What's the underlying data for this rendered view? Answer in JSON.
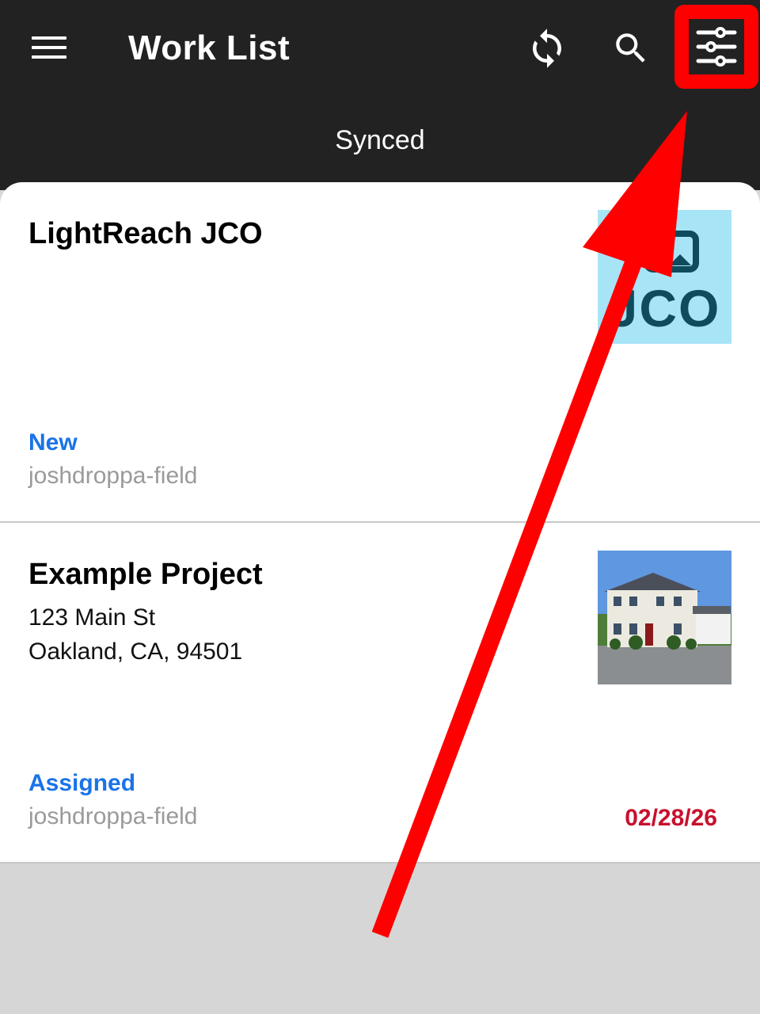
{
  "header": {
    "title": "Work List",
    "sync_status": "Synced",
    "icons": [
      "menu-icon",
      "sync-icon",
      "search-icon",
      "filter-icon"
    ],
    "background": "#222222"
  },
  "work_items": [
    {
      "name": "LightReach JCO",
      "status": "New",
      "assignee": "joshdroppa-field",
      "thumbnail_text": "JCO"
    },
    {
      "name": "Example Project",
      "address_line1": "123 Main St",
      "address_line2": "Oakland, CA, 94501",
      "status": "Assigned",
      "assignee": "joshdroppa-field",
      "due_date": "02/28/26"
    }
  ],
  "colors": {
    "status_blue": "#1a73e8",
    "date_red": "#c8102e",
    "annotation_red": "#ff0000"
  }
}
